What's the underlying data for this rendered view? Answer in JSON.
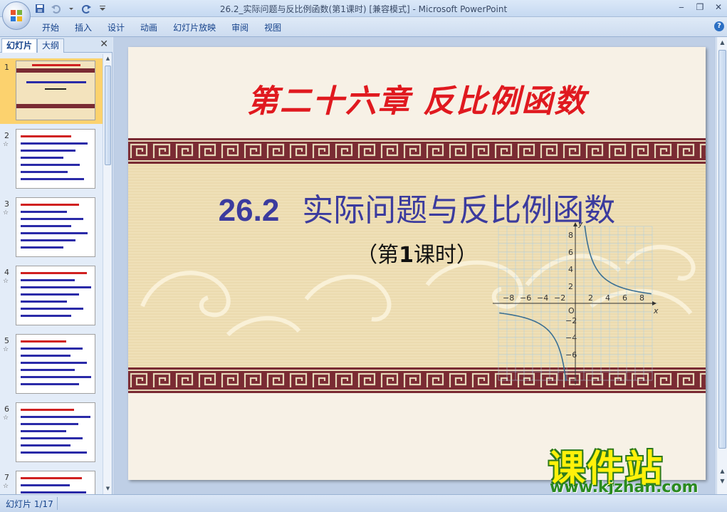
{
  "window": {
    "title": "26.2_实际问题与反比例函数(第1课时) [兼容模式] - Microsoft PowerPoint",
    "controls": [
      "‒",
      "❐",
      "✕"
    ]
  },
  "ribbon": {
    "tabs": [
      "开始",
      "插入",
      "设计",
      "动画",
      "幻灯片放映",
      "审阅",
      "视图"
    ],
    "help": "?"
  },
  "left_pane": {
    "tabs": [
      "幻灯片",
      "大纲"
    ],
    "close": "✕",
    "thumbnails": [
      {
        "number": "1",
        "anim": "",
        "selected": true
      },
      {
        "number": "2",
        "anim": "☆",
        "selected": false
      },
      {
        "number": "3",
        "anim": "☆",
        "selected": false
      },
      {
        "number": "4",
        "anim": "☆",
        "selected": false
      },
      {
        "number": "5",
        "anim": "☆",
        "selected": false
      },
      {
        "number": "6",
        "anim": "☆",
        "selected": false
      },
      {
        "number": "7",
        "anim": "☆",
        "selected": false
      }
    ]
  },
  "slide": {
    "heading": "第二十六章 反比例函数",
    "subtitle_number": "26.2",
    "subtitle_text": "实际问题与反比例函数",
    "period_pre": "（第",
    "period_num": "1",
    "period_post": "课时）",
    "graph": {
      "x_label": "x",
      "y_label": "y",
      "origin": "O",
      "x_ticks": [
        "−8",
        "−6",
        "−4",
        "−2",
        "2",
        "4",
        "6",
        "8"
      ],
      "y_ticks": [
        "8",
        "6",
        "4",
        "2",
        "−2",
        "−4",
        "−6"
      ]
    }
  },
  "watermark": {
    "big": "课件站",
    "url": "www.kjzhan.com"
  },
  "status": {
    "slide_counter": "幻灯片 1/17"
  },
  "colors": {
    "heading": "#e0191f",
    "subtitle": "#3b3b9e",
    "band": "#7a2b33",
    "selected_thumb": "#fcd26e"
  }
}
